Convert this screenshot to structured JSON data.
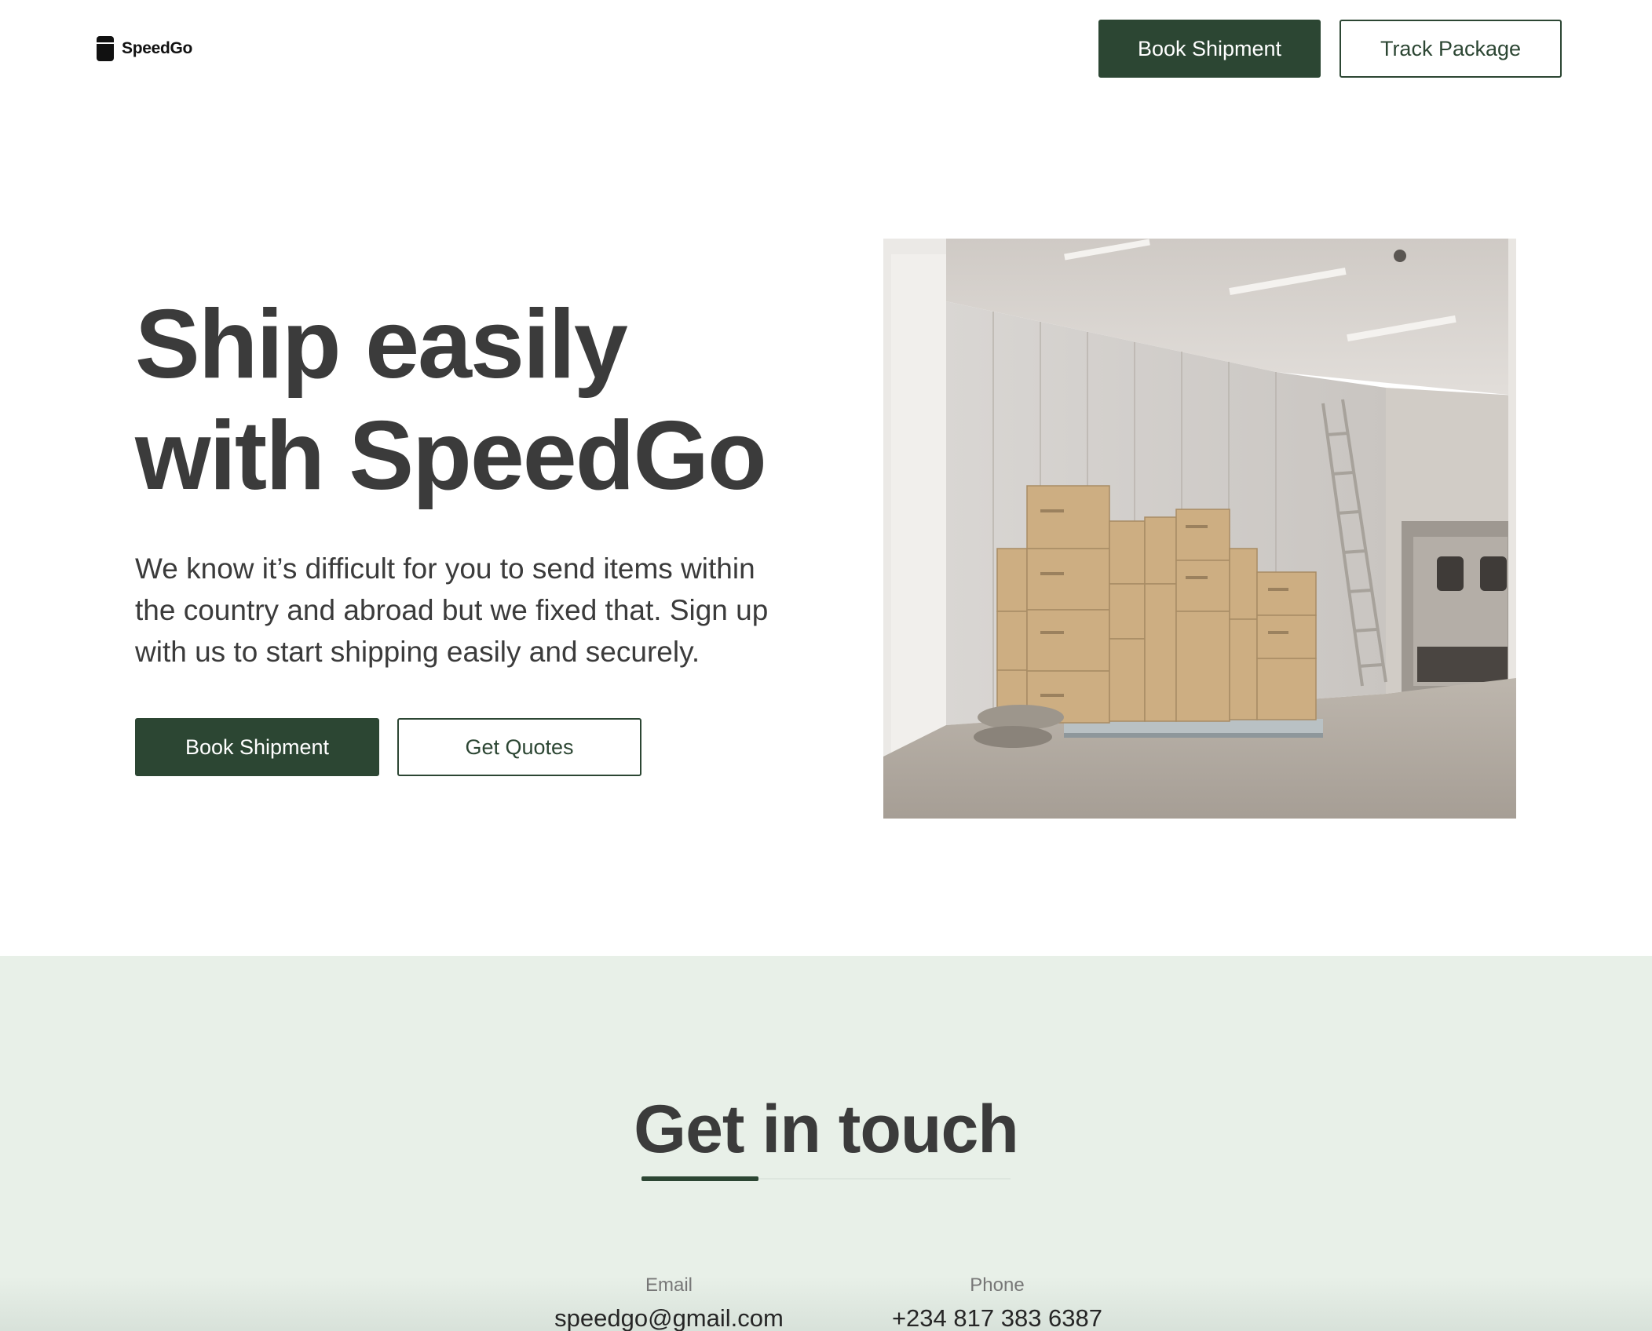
{
  "header": {
    "brand": "SpeedGo",
    "book_label": "Book Shipment",
    "track_label": "Track Package"
  },
  "hero": {
    "title_line1": "Ship easily",
    "title_line2": "with SpeedGo",
    "description": "We know it’s difficult for you to send items within the country and abroad but we fixed that. Sign up with us to start shipping easily and securely.",
    "book_label": "Book Shipment",
    "quotes_label": "Get Quotes",
    "image_alt": "warehouse with stacked cardboard boxes"
  },
  "contact": {
    "title": "Get in touch",
    "email_label": "Email",
    "email_value": "speedgo@gmail.com",
    "phone_label": "Phone",
    "phone_value": "+234 817 383 6387"
  },
  "colors": {
    "primary": "#2c4633",
    "contact_bg": "#e8f0e8",
    "text": "#3b3b3b"
  }
}
